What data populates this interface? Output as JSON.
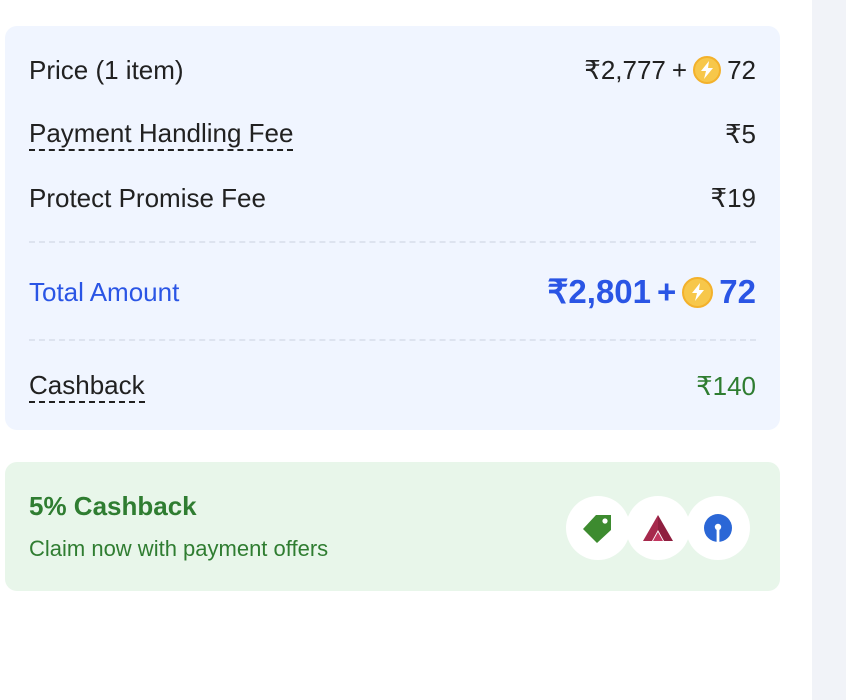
{
  "price_summary": {
    "price": {
      "label": "Price (1 item)",
      "amount": "₹2,777",
      "plus": "+",
      "coins": "72"
    },
    "handling_fee": {
      "label": "Payment Handling Fee",
      "amount": "₹5"
    },
    "protect_fee": {
      "label": "Protect Promise Fee",
      "amount": "₹19"
    },
    "total": {
      "label": "Total Amount",
      "amount": "₹2,801",
      "plus": "+",
      "coins": "72"
    },
    "cashback": {
      "label": "Cashback",
      "amount": "₹140"
    }
  },
  "offer": {
    "title": "5% Cashback",
    "subtitle": "Claim now with payment offers",
    "icons": [
      "price-tag-icon",
      "axis-bank-logo-icon",
      "sbi-bank-logo-icon"
    ]
  },
  "colors": {
    "accent_blue": "#2a55e5",
    "cashback_green": "#2f7d31",
    "summary_bg": "#f0f5ff",
    "offer_bg": "#e8f6ea",
    "coin_yellow": "#f7c74a"
  }
}
